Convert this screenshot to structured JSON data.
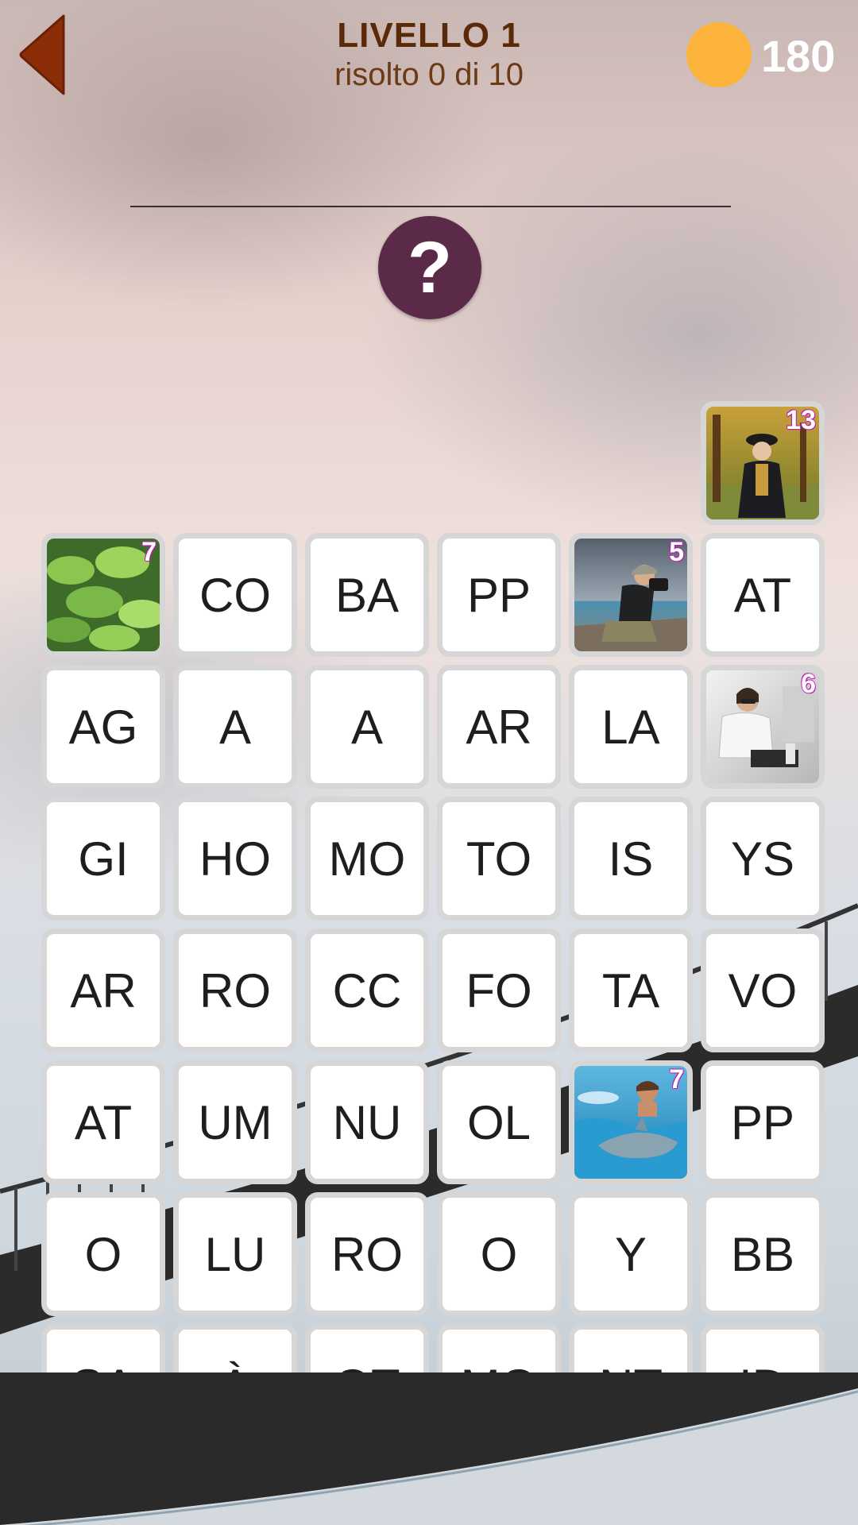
{
  "header": {
    "level_title": "LIVELLO 1",
    "progress_text": "risolto 0 di 10",
    "coins": "180"
  },
  "colors": {
    "accent_brown": "#8b2e08",
    "hint_button": "#5b2a48",
    "coin": "#fbb33c",
    "badge": "#d020c8"
  },
  "hint": {
    "label": "?"
  },
  "icons": {
    "back": "back-arrow-icon",
    "coin": "coin-icon",
    "hint": "question-icon"
  },
  "grid": {
    "rows": [
      [
        "",
        "",
        "",
        "",
        "",
        "photo:woman-victorian:13"
      ],
      [
        "photo:tobacco-field:7",
        "CO",
        "BA",
        "PP",
        "photo:photographer:5",
        "AT"
      ],
      [
        "AG",
        "A",
        "A",
        "AR",
        "LA",
        "photo:office-worker:6"
      ],
      [
        "GI",
        "HO",
        "MO",
        "TO",
        "IS",
        "YS"
      ],
      [
        "AR",
        "RO",
        "CC",
        "FO",
        "TA",
        "VO"
      ],
      [
        "AT",
        "UM",
        "NU",
        "OL",
        "photo:dolphin-swim:7",
        "PP"
      ],
      [
        "O",
        "LU",
        "RO",
        "O",
        "Y",
        "BB"
      ],
      [
        "SA",
        "À",
        "OT",
        "MO",
        "NT",
        "ID"
      ]
    ]
  },
  "photo_tiles": {
    "woman-victorian": {
      "badge": "13"
    },
    "tobacco-field": {
      "badge": "7"
    },
    "photographer": {
      "badge": "5"
    },
    "office-worker": {
      "badge": "6"
    },
    "dolphin-swim": {
      "badge": "7"
    }
  }
}
